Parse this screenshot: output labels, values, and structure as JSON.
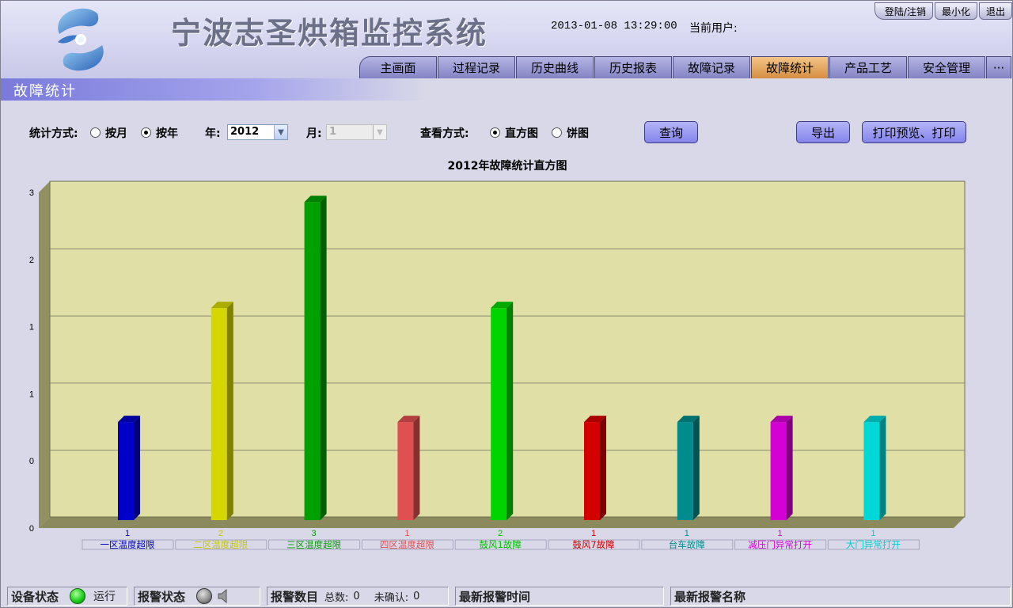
{
  "header": {
    "title": "宁波志圣烘箱监控系统",
    "datetime": "2013-01-08 13:29:00",
    "user_label": "当前用户:",
    "buttons": {
      "login": "登陆/注销",
      "minimize": "最小化",
      "exit": "退出"
    }
  },
  "nav": {
    "tabs": [
      {
        "label": "主画面",
        "active": false
      },
      {
        "label": "过程记录",
        "active": false
      },
      {
        "label": "历史曲线",
        "active": false
      },
      {
        "label": "历史报表",
        "active": false
      },
      {
        "label": "故障记录",
        "active": false
      },
      {
        "label": "故障统计",
        "active": true
      },
      {
        "label": "产品工艺",
        "active": false
      },
      {
        "label": "安全管理",
        "active": false
      }
    ],
    "more": "···"
  },
  "page_title": "故障统计",
  "controls": {
    "stat_mode_label": "统计方式:",
    "by_month": "按月",
    "by_year": "按年",
    "stat_mode_selected": "按年",
    "year_label": "年:",
    "year_value": "2012",
    "month_label": "月:",
    "month_value": "1",
    "view_mode_label": "查看方式:",
    "histogram": "直方图",
    "pie": "饼图",
    "view_mode_selected": "直方图",
    "query_button": "查询",
    "export_button": "导出",
    "print_button": "打印预览、打印"
  },
  "chart_data": {
    "type": "bar",
    "title": "2012年故障统计直方图",
    "categories": [
      "一区温度超限",
      "二区温度超限",
      "三区温度超限",
      "四区温度超限",
      "鼓风1故障",
      "鼓风7故障",
      "台车故障",
      "减压门异常打开",
      "大门异常打开"
    ],
    "values": [
      1,
      2,
      3,
      1,
      2,
      1,
      1,
      1,
      1
    ],
    "value_labels": [
      "1",
      "2",
      "3",
      "1",
      "2",
      "1",
      "1",
      "1",
      "1"
    ],
    "y_tick_labels": [
      "0",
      "0",
      "1",
      "1",
      "2",
      "3"
    ],
    "ylim": [
      0,
      3
    ],
    "grid": true,
    "colors": [
      "#0000c8",
      "#d6d600",
      "#00a000",
      "#e05050",
      "#00d400",
      "#d40000",
      "#008c8c",
      "#d400d4",
      "#00d8d8"
    ],
    "label_colors": [
      "#0000c8",
      "#c8c800",
      "#00a000",
      "#e05050",
      "#00c000",
      "#c80000",
      "#008c8c",
      "#d400d4",
      "#00d0d0"
    ]
  },
  "status_bar": {
    "device_status_label": "设备状态",
    "device_status_value": "运行",
    "alarm_status_label": "报警状态",
    "alarm_count_label": "报警数目",
    "total_label": "总数:",
    "total_value": "0",
    "unack_label": "未确认:",
    "unack_value": "0",
    "latest_time_label": "最新报警时间",
    "latest_name_label": "最新报警名称"
  }
}
